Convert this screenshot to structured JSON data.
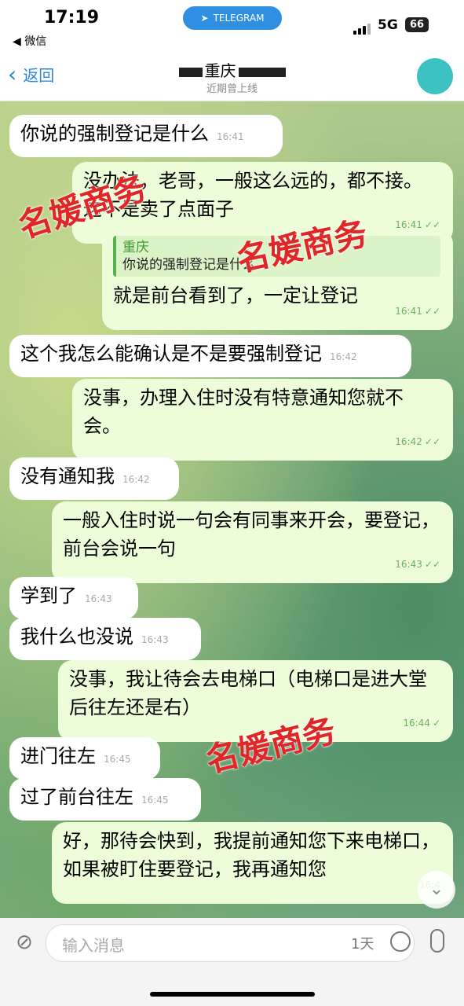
{
  "status_bar": {
    "time": "17:19",
    "back_app": "◀ 微信",
    "pill": "TELEGRAM",
    "network": "5G",
    "battery": "66"
  },
  "header": {
    "back_label": "返回",
    "title": "重庆",
    "status": "近期曾上线"
  },
  "messages": [
    {
      "side": "in",
      "text": "你说的强制登记是什么",
      "time": "16:41"
    },
    {
      "side": "out",
      "text": "没办法，老哥，一般这么远的，都不接。这不是卖了点面子",
      "time": "16:41"
    },
    {
      "side": "out",
      "quote_name": "重庆",
      "quote_text": "你说的强制登记是什么",
      "text": "就是前台看到了，一定让登记",
      "time": "16:41"
    },
    {
      "side": "in",
      "text": "这个我怎么能确认是不是要强制登记",
      "time": "16:42"
    },
    {
      "side": "out",
      "text": "没事，办理入住时没有特意通知您就不会。",
      "time": "16:42"
    },
    {
      "side": "in",
      "text": "没有通知我",
      "time": "16:42"
    },
    {
      "side": "out",
      "text": "一般入住时说一句会有同事来开会，要登记，前台会说一句",
      "time": "16:43"
    },
    {
      "side": "in",
      "text": "学到了",
      "time": "16:43"
    },
    {
      "side": "in",
      "text": "我什么也没说",
      "time": "16:43"
    },
    {
      "side": "out",
      "text": "没事，我让待会去电梯口（电梯口是进大堂后往左还是右）",
      "time": "16:44"
    },
    {
      "side": "in",
      "text": "进门往左",
      "time": "16:45"
    },
    {
      "side": "in",
      "text": "过了前台往左",
      "time": "16:45"
    },
    {
      "side": "out",
      "text": "好，那待会快到，我提前通知您下来电梯口，如果被盯住要登记，我再通知您",
      "time": "16:4"
    }
  ],
  "watermarks": [
    "名媛商务",
    "名媛商务",
    "名媛商务"
  ],
  "input": {
    "placeholder": "输入消息",
    "right_label": "1天"
  },
  "icons": {
    "back": "chevron-left-icon",
    "attach": "paperclip-icon",
    "sticker": "sticker-icon",
    "mic": "microphone-icon",
    "scroll": "chevron-down-icon",
    "telegram": "telegram-plane-icon"
  },
  "colors": {
    "accent": "#2b86de",
    "outgoing_bubble": "#eefdd9",
    "incoming_bubble": "#ffffff",
    "watermark": "#e02626"
  }
}
